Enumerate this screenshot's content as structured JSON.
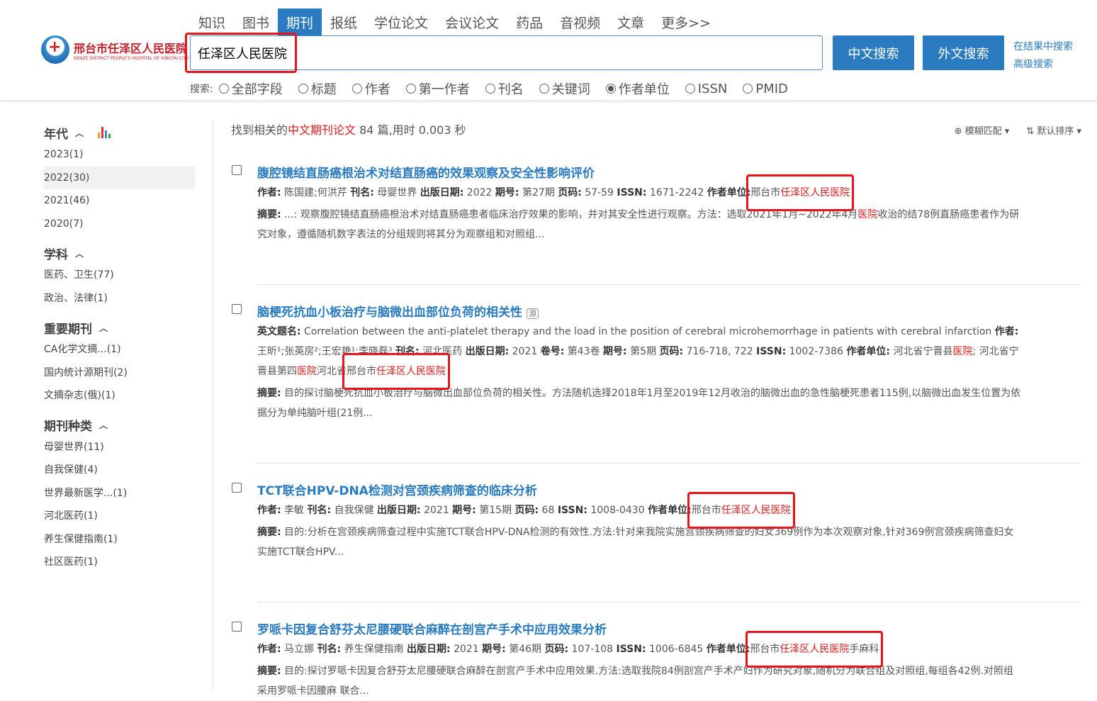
{
  "nav": {
    "tabs": [
      "知识",
      "图书",
      "期刊",
      "报纸",
      "学位论文",
      "会议论文",
      "药品",
      "音视频",
      "文章",
      "更多>>"
    ],
    "active": 2
  },
  "logo": {
    "cn": "邢台市任泽区人民医院",
    "en": "RENZE DISTRICT PEOPLE'S HOSPITAL OF XINGTAI CITY"
  },
  "search": {
    "value": "任泽区人民医院",
    "btn_cn": "中文搜索",
    "btn_foreign": "外文搜索",
    "link_within": "在结果中搜索",
    "link_advanced": "高级搜索"
  },
  "options": {
    "label": "搜索:",
    "items": [
      "全部字段",
      "标题",
      "作者",
      "第一作者",
      "刊名",
      "关键词",
      "作者单位",
      "ISSN",
      "PMID"
    ],
    "selected": 6
  },
  "sidebar": [
    {
      "title": "年代",
      "chart_icon": true,
      "items": [
        "2023(1)",
        "2022(30)",
        "2021(46)",
        "2020(7)"
      ],
      "selected": 1
    },
    {
      "title": "学科",
      "items": [
        "医药、卫生(77)",
        "政治、法律(1)"
      ]
    },
    {
      "title": "重要期刊",
      "items": [
        "CA化学文摘...(1)",
        "国内统计源期刊(2)",
        "文摘杂志(俄)(1)"
      ]
    },
    {
      "title": "期刊种类",
      "items": [
        "母婴世界(11)",
        "自我保健(4)",
        "世界最新医学...(1)",
        "河北医药(1)",
        "养生保健指南(1)",
        "社区医药(1)"
      ]
    }
  ],
  "summary": {
    "pre": "找到相关的",
    "type": "中文期刊论文",
    "post": " 84 篇,用时 0.003 秒"
  },
  "tools": {
    "match": "模糊匹配",
    "sort": "默认排序"
  },
  "results": [
    {
      "title": "腹腔镜结直肠癌根治术对结直肠癌的效果观察及安全性影响评价",
      "lines": [
        [
          [
            "b",
            "作者:"
          ],
          [
            "t",
            " 陈国建;何洪芹  "
          ],
          [
            "b",
            "刊名:"
          ],
          [
            "t",
            " 母婴世界  "
          ],
          [
            "b",
            "出版日期:"
          ],
          [
            "t",
            " 2022  "
          ],
          [
            "b",
            "期号:"
          ],
          [
            "t",
            " 第27期  "
          ],
          [
            "b",
            "页码:"
          ],
          [
            "t",
            " 57-59  "
          ],
          [
            "b",
            "ISSN:"
          ],
          [
            "t",
            " 1671-2242  "
          ],
          [
            "b",
            "作者单位:"
          ],
          [
            "box",
            [
              [
                "t",
                "邢台市"
              ],
              [
                "h",
                "任泽区人民医院"
              ]
            ]
          ]
        ],
        [
          [
            "b",
            "摘要:"
          ],
          [
            "t",
            " ...: 观察腹腔镜结直肠癌根治术对结直肠癌患者临床治疗效果的影响，并对其安全性进行观察。方法：选取2021年1月~2022年4月"
          ],
          [
            "h",
            "医院"
          ],
          [
            "t",
            "收治的结78例直肠癌患者作为研究对象，遵循随机数字表法的分组规则将其分为观察组和对照组..."
          ]
        ]
      ]
    },
    {
      "title": "脑梗死抗血小板治疗与脑微出血部位负荷的相关性",
      "source_icon": "源",
      "lines": [
        [
          [
            "b",
            "英文题名:"
          ],
          [
            "t",
            " Correlation between the anti-platelet therapy and the load in the position of cerebral microhemorrhage in patients with cerebral infarction  "
          ],
          [
            "b",
            "作者:"
          ],
          [
            "t",
            " 王昕¹;张英房²;王宏艳¹;李晓磊³  "
          ],
          [
            "b",
            "刊名:"
          ],
          [
            "t",
            " 河北医药  "
          ],
          [
            "b",
            "出版日期:"
          ],
          [
            "t",
            " 2021  "
          ],
          [
            "b",
            "卷号:"
          ],
          [
            "t",
            " 第43卷  "
          ],
          [
            "b",
            "期号:"
          ],
          [
            "t",
            " 第5期  "
          ],
          [
            "b",
            "页码:"
          ],
          [
            "t",
            " 716-718, 722  "
          ],
          [
            "b",
            "ISSN:"
          ],
          [
            "t",
            " 1002-7386  "
          ],
          [
            "b",
            "作者单位:"
          ],
          [
            "t",
            " 河北省宁晋县"
          ],
          [
            "h",
            "医院"
          ],
          [
            "t",
            "; 河北省宁晋县第四"
          ],
          [
            "h",
            "医院"
          ],
          [
            "t",
            "河北省"
          ],
          [
            "box",
            [
              [
                "t",
                "邢台市"
              ],
              [
                "h",
                "任泽区人民医院"
              ]
            ]
          ]
        ],
        [
          [
            "b",
            "摘要:"
          ],
          [
            "t",
            " 目的探讨脑梗死抗血小板治疗与脑微出血部位负荷的相关性。方法随机选择2018年1月至2019年12月收治的脑微出血的急性脑梗死患者115例,以脑微出血发生位置为依据分为单纯脑叶组(21例..."
          ]
        ]
      ]
    },
    {
      "title": "TCT联合HPV-DNA检测对宫颈疾病筛查的临床分析",
      "lines": [
        [
          [
            "b",
            "作者:"
          ],
          [
            "t",
            " 李敏  "
          ],
          [
            "b",
            "刊名:"
          ],
          [
            "t",
            " 自我保健  "
          ],
          [
            "b",
            "出版日期:"
          ],
          [
            "t",
            " 2021  "
          ],
          [
            "b",
            "期号:"
          ],
          [
            "t",
            " 第15期  "
          ],
          [
            "b",
            "页码:"
          ],
          [
            "t",
            " 68  "
          ],
          [
            "b",
            "ISSN:"
          ],
          [
            "t",
            " 1008-0430  "
          ],
          [
            "b",
            "作者单位:"
          ],
          [
            "box",
            [
              [
                "t",
                "邢台市"
              ],
              [
                "h",
                "任泽区人民医院"
              ]
            ]
          ]
        ],
        [
          [
            "b",
            "摘要:"
          ],
          [
            "t",
            " 目的:分析在宫颈疾病筛查过程中实施TCT联合HPV-DNA检测的有效性.方法:针对来我院实施宫颈疾病筛查的妇女369例作为本次观察对象,针对369例宫颈疾病筛查妇女实施TCT联合HPV..."
          ]
        ]
      ]
    },
    {
      "title": "罗哌卡因复合舒芬太尼腰硬联合麻醉在剖宫产手术中应用效果分析",
      "lines": [
        [
          [
            "b",
            "作者:"
          ],
          [
            "t",
            " 马立娜  "
          ],
          [
            "b",
            "刊名:"
          ],
          [
            "t",
            " 养生保健指南  "
          ],
          [
            "b",
            "出版日期:"
          ],
          [
            "t",
            " 2021  "
          ],
          [
            "b",
            "期号:"
          ],
          [
            "t",
            " 第46期  "
          ],
          [
            "b",
            "页码:"
          ],
          [
            "t",
            " 107-108  "
          ],
          [
            "b",
            "ISSN:"
          ],
          [
            "t",
            " 1006-6845  "
          ],
          [
            "b",
            "作者单位:"
          ],
          [
            "box",
            [
              [
                "t",
                "邢台市"
              ],
              [
                "h",
                "任泽区人民医院"
              ],
              [
                "t",
                "手麻科"
              ]
            ]
          ]
        ],
        [
          [
            "b",
            "摘要:"
          ],
          [
            "t",
            " 目的:探讨罗哌卡因复合舒芬太尼腰硬联合麻醉在剖宫产手术中应用效果.方法:选取我院84例剖宫产手术产妇作为研究对象,随机分为联合组及对照组,每组各42例.对照组采用罗哌卡因腰麻 联合..."
          ]
        ]
      ]
    }
  ]
}
